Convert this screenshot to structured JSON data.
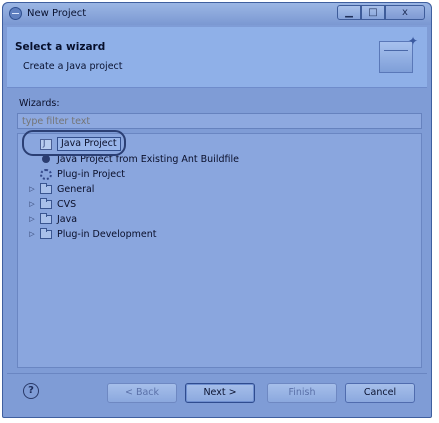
{
  "window": {
    "title": "New Project"
  },
  "header": {
    "title": "Select a wizard",
    "subtitle": "Create a Java project"
  },
  "wizards_label": "Wizards:",
  "filter": {
    "placeholder": "type filter text",
    "value": ""
  },
  "tree": {
    "items": [
      {
        "label": "Java Project",
        "icon": "java-project-icon",
        "selected": true
      },
      {
        "label": "Java Project from Existing Ant Buildfile",
        "icon": "ant-icon"
      },
      {
        "label": "Plug-in Project",
        "icon": "plugin-project-icon"
      },
      {
        "label": "General",
        "icon": "folder-icon",
        "expandable": true
      },
      {
        "label": "CVS",
        "icon": "folder-icon",
        "expandable": true
      },
      {
        "label": "Java",
        "icon": "folder-icon",
        "expandable": true
      },
      {
        "label": "Plug-in Development",
        "icon": "folder-icon",
        "expandable": true
      }
    ]
  },
  "buttons": {
    "back": "< Back",
    "next": "Next >",
    "finish": "Finish",
    "cancel": "Cancel",
    "help": "?"
  },
  "window_buttons": {
    "minimize": "▁",
    "maximize": "□",
    "close": "x"
  }
}
